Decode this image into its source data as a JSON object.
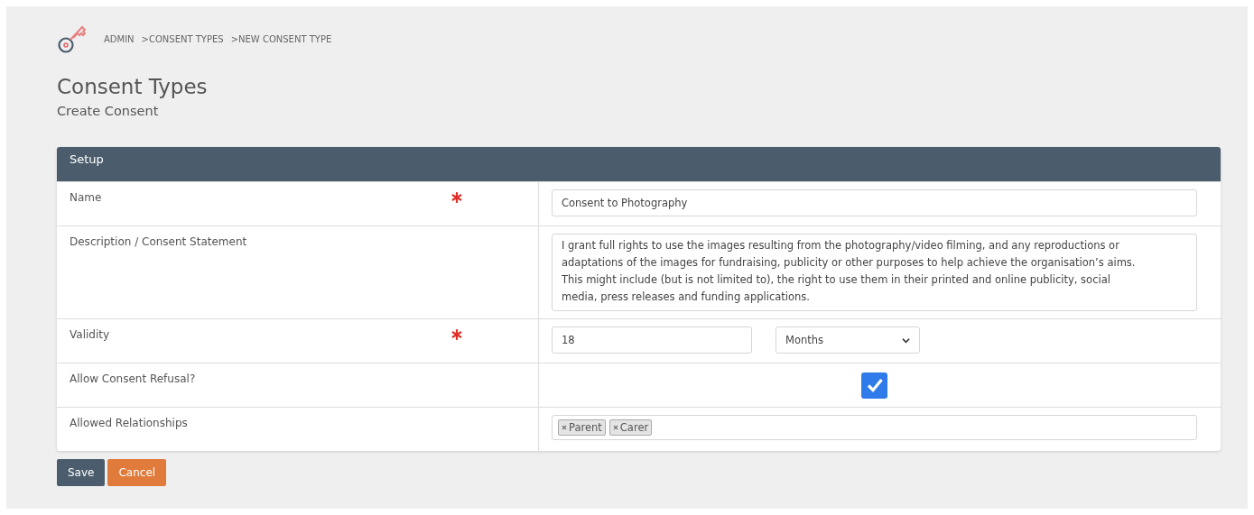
{
  "breadcrumb": [
    "ADMIN",
    ">CONSENT TYPES",
    ">NEW CONSENT TYPE"
  ],
  "page_title": "Consent Types",
  "subtitle": "Create Consent",
  "panel": {
    "title": "Setup",
    "rows": [
      {
        "kind": "text",
        "label": "Name",
        "required": true,
        "value": "Consent to Photography"
      },
      {
        "kind": "textarea",
        "label": "Description / Consent Statement",
        "required": false,
        "value": "I grant full rights to use the images resulting from the photography/video filming, and any reproductions or\nadaptations of the images for fundraising, publicity or other purposes to help achieve the organisation’s aims.\nThis might include (but is not limited to), the right to use them in their printed and online publicity, social\nmedia, press releases and funding applications."
      },
      {
        "kind": "validity",
        "label": "Validity",
        "required": true,
        "value": "18",
        "unit": "Months"
      },
      {
        "kind": "checkbox",
        "label": "Allow Consent Refusal?",
        "required": false,
        "checked": true
      },
      {
        "kind": "tags",
        "label": "Allowed Relationships",
        "required": false,
        "tags": [
          "Parent",
          "Carer"
        ]
      }
    ]
  },
  "buttons": [
    {
      "kind": "primary",
      "label": "Save"
    },
    {
      "kind": "secondary",
      "label": "Cancel"
    }
  ]
}
